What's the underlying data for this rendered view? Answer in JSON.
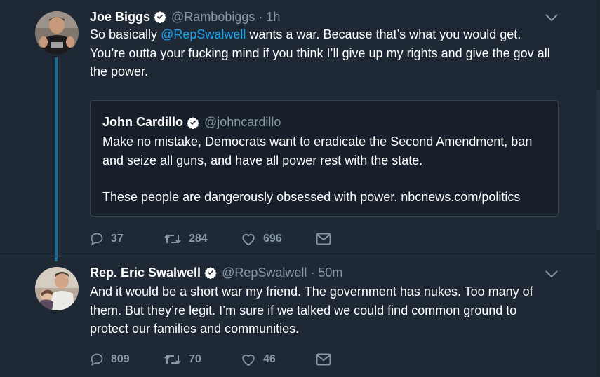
{
  "tweets": [
    {
      "name": "Joe Biggs",
      "handle": "@Rambobiggs",
      "separator": "·",
      "time": "1h",
      "text_before": "So basically ",
      "mention": "@RepSwalwell",
      "text_after": " wants a war. Because that’s what you would get. You’re outta your fucking mind if you think I’ll give up my rights and give the gov all the power.",
      "avatar_shirt_text": "",
      "quote": {
        "name": "John Cardillo",
        "handle": "@johncardillo",
        "paragraph1": "Make no mistake, Democrats want to eradicate the Second Amendment, ban and seize all guns, and have all power rest with the state.",
        "paragraph2": "These people are dangerously obsessed with power.  nbcnews.com/politics"
      },
      "actions": {
        "replies": "37",
        "retweets": "284",
        "likes": "696"
      }
    },
    {
      "name": "Rep. Eric Swalwell",
      "handle": "@RepSwalwell",
      "separator": "·",
      "time": "50m",
      "text": "And it would be a short war my friend. The government has nukes. Too many of them. But they’re legit. I’m sure if we talked we could find common ground to protect our families and communities.",
      "actions": {
        "replies": "809",
        "retweets": "70",
        "likes": "46"
      }
    }
  ],
  "colors": {
    "background": "#1f2935",
    "quote_background": "#17202b",
    "border": "#38444d",
    "muted_text": "#8899a6",
    "link": "#1da1f2",
    "thread_line": "#1c6b94"
  },
  "icons": [
    "reply-icon",
    "retweet-icon",
    "like-icon",
    "direct-message-icon",
    "verified-badge-icon",
    "chevron-down-icon"
  ]
}
